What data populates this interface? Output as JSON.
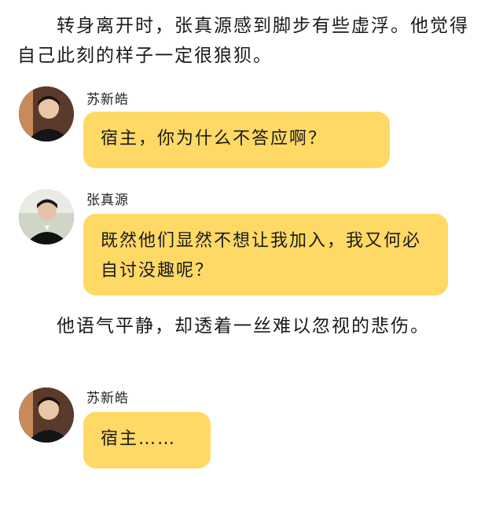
{
  "story": {
    "paragraph_1": "　　转身离开时，张真源感到脚步有些虚浮。他觉得自己此刻的样子一定很狼狈。",
    "paragraph_2": "　　他语气平静，却透着一丝难以忽视的悲伤。"
  },
  "messages": [
    {
      "sender": "苏新皓",
      "text": "宿主，你为什么不答应啊？"
    },
    {
      "sender": "张真源",
      "text": "既然他们显然不想让我加入，我又何必自讨没趣呢？"
    },
    {
      "sender": "苏新皓",
      "text": "宿主……"
    }
  ],
  "colors": {
    "bubble": "#ffd966",
    "background": "#ffffff"
  }
}
